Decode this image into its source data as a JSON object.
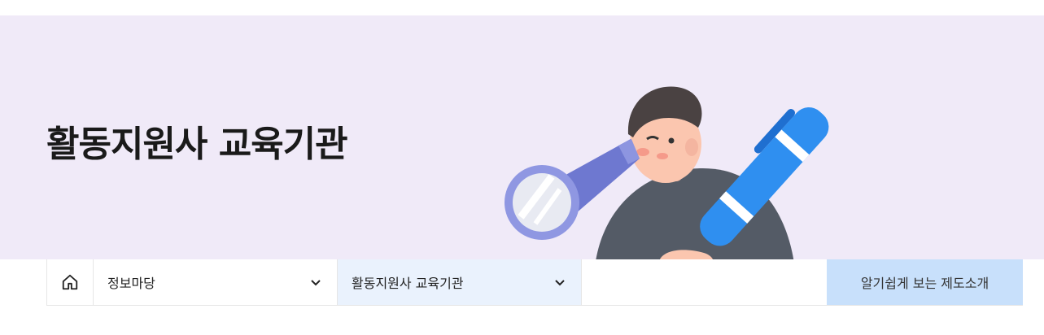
{
  "hero": {
    "title": "활동지원사 교육기관"
  },
  "nav": {
    "home_icon": "home-icon",
    "level1": {
      "label": "정보마당",
      "icon": "chevron-down-icon"
    },
    "level2": {
      "label": "활동지원사 교육기관",
      "icon": "chevron-down-icon"
    },
    "intro_button": "알기쉽게 보는 제도소개"
  },
  "colors": {
    "hero_bg": "#f0eaf8",
    "active_select_bg": "#eaf2fd",
    "intro_button_bg": "#c8e0fb",
    "telescope": "#6e78d0",
    "pen": "#2f8ff0"
  }
}
